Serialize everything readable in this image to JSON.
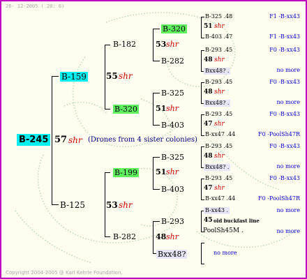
{
  "header": {
    "date": "26- 12-2005 ( 20: 6)"
  },
  "footer": {
    "copyright": "Copyright 2004-2005 @ Karl Kehrle Foundation."
  },
  "root": {
    "label": "B-245",
    "number": "57",
    "shr": "shr",
    "note": "(Drones from 4 sister colonies)"
  },
  "gen1": {
    "upper": "B-159",
    "lower": "B-125"
  },
  "gen2": [
    {
      "number": "55",
      "shr": "shr"
    },
    {
      "number": "53",
      "shr": "shr"
    }
  ],
  "gen3": [
    "B-182",
    "B-320",
    "B-199",
    "B-282"
  ],
  "gen3_nums": [
    {
      "number": "53",
      "shr": "shr"
    },
    {
      "number": "51",
      "shr": "shr"
    },
    {
      "number": "51",
      "shr": "shr"
    },
    {
      "number": "48",
      "shr": "shr"
    }
  ],
  "gen4": [
    "B-320",
    "B-282",
    "B-325",
    "B-403",
    "B-325",
    "B-403",
    "B-293",
    "Bxx48?"
  ],
  "gen5": [
    {
      "a": "B-325 .48",
      "a_right": "F1 -B-xx43",
      "num": "51",
      "shr": "shr",
      "b": "B-403 .47",
      "b_right": "F1 -B-xx43"
    },
    {
      "a": "B-293 .45",
      "a_right": "F0 -B-xx43",
      "num": "48",
      "shr": "shr",
      "b": "Bxx48? .",
      "b_right": "no more"
    },
    {
      "a": "B-293 .45",
      "a_right": "F0 -B-xx43",
      "num": "48",
      "shr": "shr",
      "b": "Bxx48? .",
      "b_right": "no more"
    },
    {
      "a": "B-293 .45",
      "a_right": "F0 -B-xx43",
      "num": "47",
      "shr": "shr",
      "b": "B-xx47 .44",
      "b_right": "F0 -PoolSh47R"
    },
    {
      "a": "B-293 .45",
      "a_right": "F0 -B-xx43",
      "num": "48",
      "shr": "shr",
      "b": "Bxx48? .",
      "b_right": "no more"
    },
    {
      "a": "B-293 .45",
      "a_right": "F0 -B-xx43",
      "num": "47",
      "shr": "shr",
      "b": "B-xx47 .44",
      "b_right": "F0 -PoolSh47R"
    },
    {
      "a": "B-xx43 .",
      "a_right": "no more",
      "num": "45",
      "extra": "old buckfast line",
      "b": "PoolSh45M .",
      "b_right": "no more"
    },
    {
      "single": "no more"
    }
  ]
}
